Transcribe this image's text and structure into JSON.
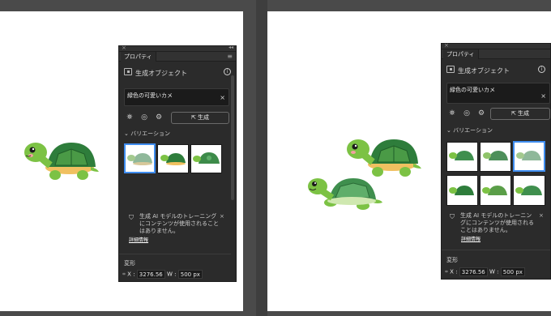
{
  "panel": {
    "tab": "プロパティ",
    "menu_icon": "hamburger-menu-icon",
    "section_title": "生成オブジェクト",
    "prompt": "緑色の可愛いカメ",
    "generate_label": "生成",
    "variations_label": "バリエーション",
    "notice_text": "生成 AI モデルのトレーニングにコンテンツが使用されることはありません。",
    "notice_link": "詳細情報",
    "transform_label": "変形",
    "x_label": "X :",
    "x_value": "3276.56",
    "w_label": "W :",
    "w_value": "500 px"
  },
  "colors": {
    "panel_bg": "#2b2b2b",
    "selection": "#3f8df0",
    "turtle_shell": "#2e7d3b",
    "turtle_skin": "#7cc244"
  }
}
